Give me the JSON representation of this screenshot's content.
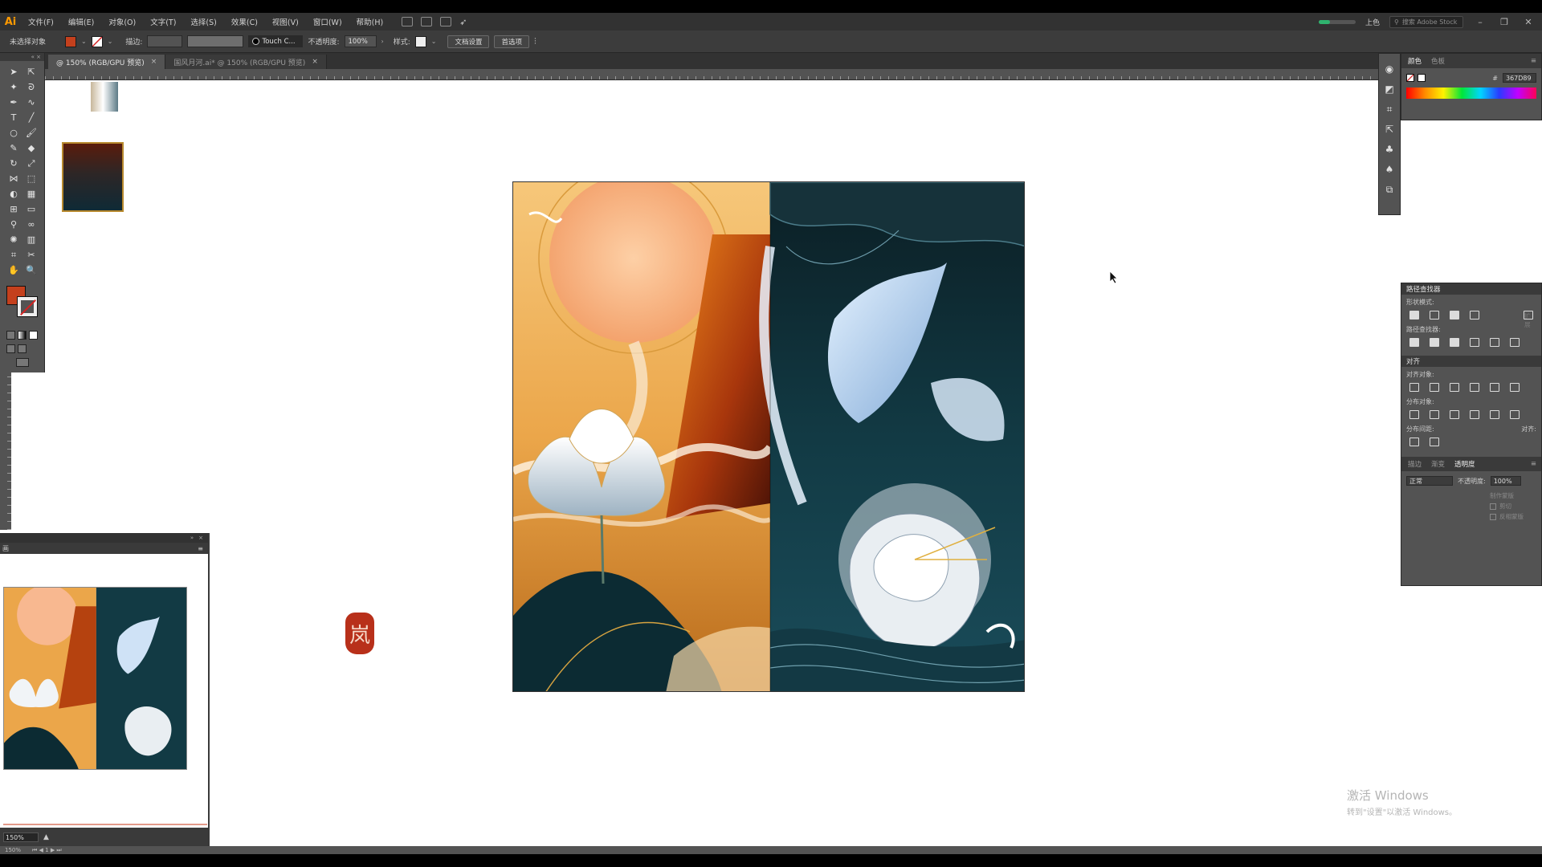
{
  "app": {
    "logo": "Ai"
  },
  "menu": [
    "文件(F)",
    "编辑(E)",
    "对象(O)",
    "文字(T)",
    "选择(S)",
    "效果(C)",
    "视图(V)",
    "窗口(W)",
    "帮助(H)"
  ],
  "menu_right": {
    "workspace": "上色",
    "search_placeholder": "搜索 Adobe Stock",
    "win_min": "–",
    "win_restore": "❐",
    "win_close": "✕"
  },
  "control": {
    "selection": "未选择对象",
    "fill_color": "#c4401d",
    "stroke_label": "描边:",
    "brush": "Touch C...",
    "opacity_label": "不透明度:",
    "opacity": "100%",
    "style_label": "样式:",
    "doc_setup": "文档设置",
    "prefs": "首选项"
  },
  "tabs": [
    {
      "label": "@ 150% (RGB/GPU 预览)",
      "active": true
    },
    {
      "label": "国风月河.ai* @ 150% (RGB/GPU 预览)",
      "active": false
    }
  ],
  "tool_icons": [
    "selection-icon",
    "direct-selection-icon",
    "magic-wand-icon",
    "lasso-icon",
    "pen-icon",
    "curvature-icon",
    "type-icon",
    "line-icon",
    "ellipse-icon",
    "paintbrush-icon",
    "pencil-icon",
    "eraser-icon",
    "rotate-icon",
    "scale-icon",
    "width-icon",
    "free-transform-icon",
    "shape-builder-icon",
    "perspective-icon",
    "mesh-icon",
    "gradient-icon",
    "eyedropper-icon",
    "blend-icon",
    "symbol-sprayer-icon",
    "graph-icon",
    "artboard-icon",
    "slice-icon",
    "hand-icon",
    "zoom-icon"
  ],
  "tool_glyphs": [
    "➤",
    "⇱",
    "✦",
    "ᘐ",
    "✒",
    "∿",
    "T",
    "╱",
    "○",
    "🖌",
    "✎",
    "◆",
    "↻",
    "⤢",
    "⋈",
    "⬚",
    "◐",
    "▦",
    "⊞",
    "▭",
    "⚲",
    "∞",
    "✺",
    "▥",
    "⌗",
    "✂",
    "✋",
    "🔍"
  ],
  "canvas": {
    "seal_char": "岚"
  },
  "navigator": {
    "title": "画",
    "zoom": "150%",
    "status_zoom": "150%"
  },
  "color_panel": {
    "tab1": "颜色",
    "tab2": "色板",
    "hex": "367D89"
  },
  "pathfinder": {
    "title": "路径查找器",
    "shape_modes": "形状模式:",
    "expand": "扩展",
    "pathfinders": "路径查找器:"
  },
  "align": {
    "title": "对齐",
    "align_objects": "对齐对象:",
    "distribute_objects": "分布对象:",
    "distribute_spacing": "分布间距:",
    "align_to": "对齐:"
  },
  "transparency": {
    "tab1": "描边",
    "tab2": "渐变",
    "tab3": "透明度",
    "blend_mode": "正常",
    "opacity_label": "不透明度:",
    "opacity": "100%",
    "make_mask": "制作蒙版",
    "clip": "剪切",
    "invert": "反相蒙版"
  },
  "watermark": {
    "title": "激活 Windows",
    "subtitle": "转到\"设置\"以激活 Windows。"
  }
}
